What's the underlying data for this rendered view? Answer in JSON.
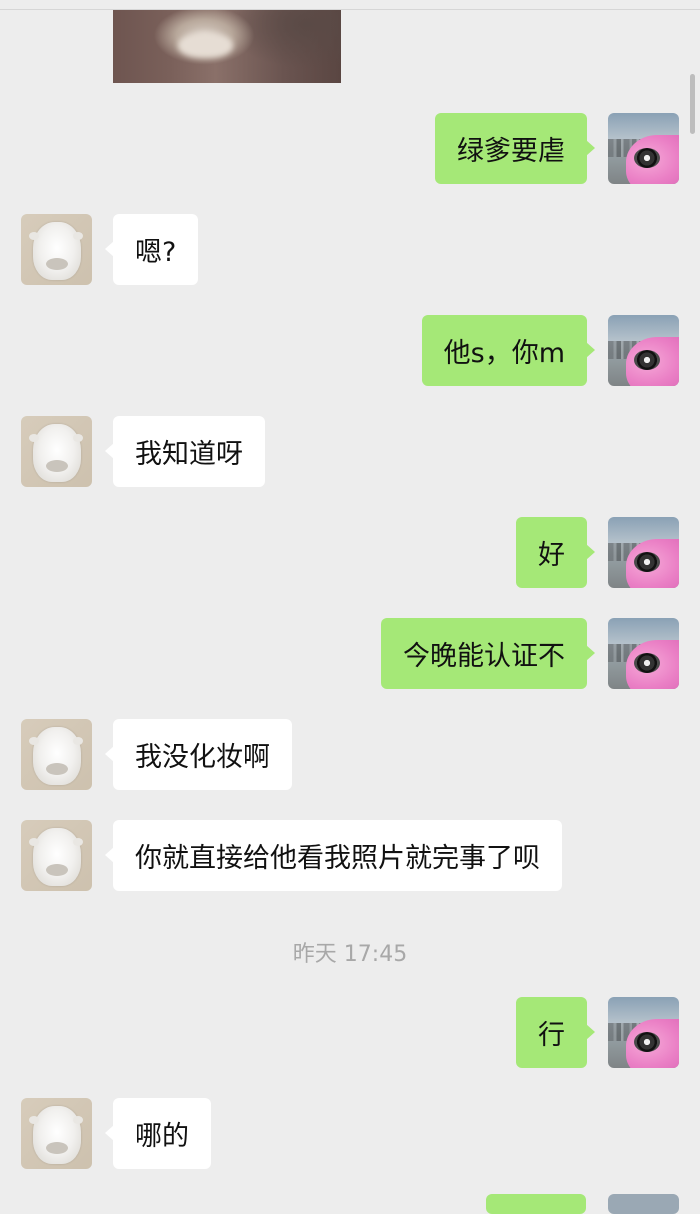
{
  "chat": {
    "messages": [
      {
        "side": "out",
        "text": "绿爹要虐"
      },
      {
        "side": "in",
        "text": "嗯?"
      },
      {
        "side": "out",
        "text": "他s，你m"
      },
      {
        "side": "in",
        "text": "我知道呀"
      },
      {
        "side": "out",
        "text": "好"
      },
      {
        "side": "out",
        "text": "今晚能认证不"
      },
      {
        "side": "in",
        "text": "我没化妆啊"
      },
      {
        "side": "in",
        "text": "你就直接给他看我照片就完事了呗"
      },
      {
        "side": "out",
        "text": "行"
      },
      {
        "side": "in",
        "text": "哪的"
      }
    ],
    "timestamp": "昨天 17:45"
  },
  "colors": {
    "background": "#ededed",
    "outgoing_bubble": "#a5e877",
    "incoming_bubble": "#ffffff",
    "timestamp_text": "#a8a8a8"
  },
  "icons": {
    "self_avatar": "pink-car-avatar",
    "contact_avatar": "hamster-avatar"
  }
}
